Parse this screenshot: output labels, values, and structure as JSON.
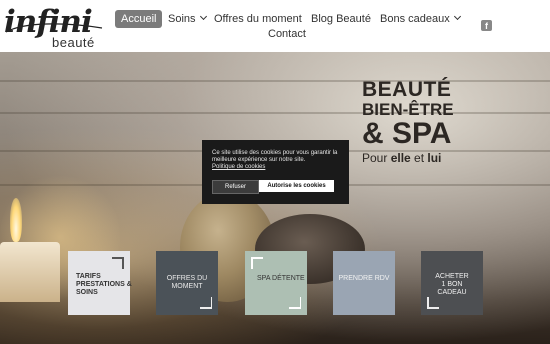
{
  "brand": {
    "logo_main": "infini",
    "logo_sub": "beauté"
  },
  "nav": {
    "items": [
      {
        "label": "Accueil",
        "active": true
      },
      {
        "label": "Soins",
        "dropdown": true
      },
      {
        "label": "Offres du moment"
      },
      {
        "label": "Blog Beauté"
      },
      {
        "label": "Bons cadeaux",
        "dropdown": true
      },
      {
        "label": "Contact"
      }
    ],
    "facebook_icon": "facebook-icon"
  },
  "hero": {
    "line1": "BEAUTÉ",
    "line2": "BIEN-ÊTRE",
    "line3": "& SPA",
    "line4_prefix": "Pour ",
    "line4_elle": "elle",
    "line4_mid": " et ",
    "line4_lui": "lui"
  },
  "cookie": {
    "text": "Ce site utilise des cookies pour vous garantir la meilleure expérience sur notre site.",
    "link": "Politique de cookies",
    "refuse": "Refuser",
    "accept": "Autorise les cookies"
  },
  "tiles": [
    {
      "label": "TARIFS PRESTATIONS & SOINS",
      "color": "#e5e5e8",
      "text_color": "#333333"
    },
    {
      "label": "OFFRES DU MOMENT",
      "color": "#4b5258",
      "text_color": "#e8e8e8"
    },
    {
      "label": "SPA DÉTENTE",
      "color": "#adbfb3",
      "text_color": "#333333"
    },
    {
      "label": "PRENDRE RDV",
      "color": "#9aa5b3",
      "text_color": "#f2f2f2"
    },
    {
      "label": "ACHETER 1 BON CADEAU",
      "color": "#4d4f52",
      "text_color": "#f0f0f0"
    }
  ]
}
